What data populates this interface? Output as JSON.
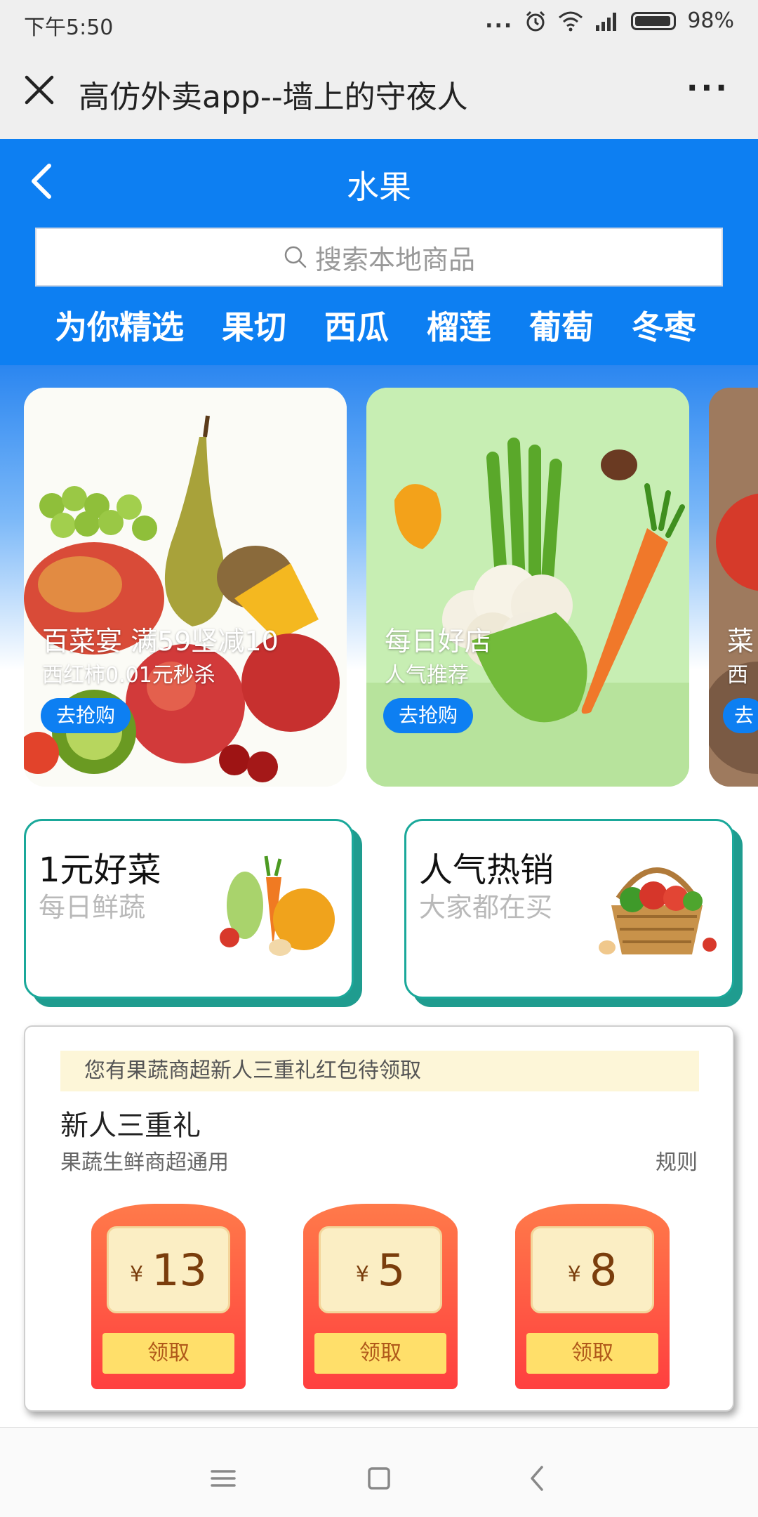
{
  "status_bar": {
    "time": "下午5:50",
    "dots": "...",
    "battery_text": "98%"
  },
  "title_bar": {
    "title": "高仿外卖app--墙上的守夜人",
    "more": "···"
  },
  "header": {
    "title": "水果",
    "search_placeholder": "搜索本地商品",
    "tabs": [
      "为你精选",
      "果切",
      "西瓜",
      "榴莲",
      "葡萄",
      "冬枣"
    ]
  },
  "banners": [
    {
      "headline": "百菜宴 满59坚减10",
      "subline": "西红柿0.01元秒杀",
      "cta": "去抢购"
    },
    {
      "headline": "每日好店",
      "subline": "人气推荐",
      "cta": "去抢购"
    },
    {
      "headline": "菜",
      "subline": "西",
      "cta": "去"
    }
  ],
  "promos": [
    {
      "title": "1元好菜",
      "subtitle": "每日鲜蔬"
    },
    {
      "title": "人气热销",
      "subtitle": "大家都在买"
    }
  ],
  "coupon_section": {
    "notice": "您有果蔬商超新人三重礼红包待领取",
    "title": "新人三重礼",
    "subtitle": "果蔬生鲜商超通用",
    "rule": "规则",
    "currency": "¥",
    "packs": [
      {
        "amount": "13",
        "button": "领取"
      },
      {
        "amount": "5",
        "button": "领取"
      },
      {
        "amount": "8",
        "button": "领取"
      }
    ]
  },
  "colors": {
    "primary_blue": "#0d7ff2",
    "teal": "#1aa89a",
    "red_packet": "#ff4f3f",
    "gold_button": "#ffdf6a"
  }
}
